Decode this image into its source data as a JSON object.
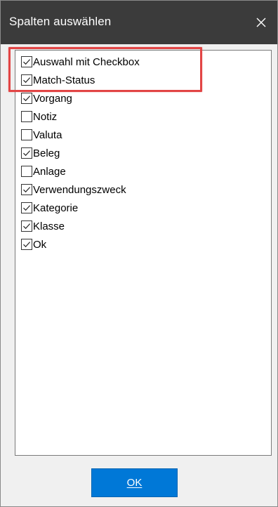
{
  "dialog": {
    "title": "Spalten auswählen",
    "close_icon": "close-icon",
    "ok_label": "OK",
    "accent_color": "#0078d7",
    "highlight_color": "#e24545"
  },
  "columns": [
    {
      "label": "Auswahl mit Checkbox",
      "checked": true
    },
    {
      "label": "Match-Status",
      "checked": true
    },
    {
      "label": "Vorgang",
      "checked": true
    },
    {
      "label": "Notiz",
      "checked": false
    },
    {
      "label": "Valuta",
      "checked": false
    },
    {
      "label": "Beleg",
      "checked": true
    },
    {
      "label": "Anlage",
      "checked": false
    },
    {
      "label": "Verwendungszweck",
      "checked": true
    },
    {
      "label": "Kategorie",
      "checked": true
    },
    {
      "label": "Klasse",
      "checked": true
    },
    {
      "label": "Ok",
      "checked": true
    }
  ]
}
